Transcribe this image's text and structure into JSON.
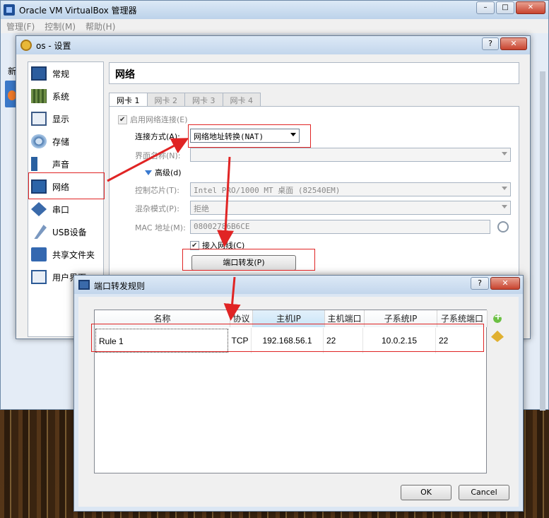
{
  "manager": {
    "title": "Oracle VM VirtualBox 管理器",
    "menu": [
      "管理(F)",
      "控制(M)",
      "帮助(H)"
    ],
    "new_label": "新",
    "win_min": "–",
    "win_max": "□",
    "win_close": "✕"
  },
  "settings": {
    "title": "os - 设置",
    "help": "?",
    "close": "✕",
    "page_title": "网络",
    "categories": [
      {
        "label": "常规",
        "icon": "general-icon"
      },
      {
        "label": "系统",
        "icon": "system-icon"
      },
      {
        "label": "显示",
        "icon": "display-icon"
      },
      {
        "label": "存储",
        "icon": "storage-icon"
      },
      {
        "label": "声音",
        "icon": "audio-icon"
      },
      {
        "label": "网络",
        "icon": "network-icon"
      },
      {
        "label": "串口",
        "icon": "serial-port-icon"
      },
      {
        "label": "USB设备",
        "icon": "usb-icon"
      },
      {
        "label": "共享文件夹",
        "icon": "shared-folder-icon"
      },
      {
        "label": "用户界面",
        "icon": "user-interface-icon"
      }
    ],
    "selected_category": "网络",
    "tabs": [
      "网卡 1",
      "网卡 2",
      "网卡 3",
      "网卡 4"
    ],
    "enable_adapter": "启用网络连接(E)",
    "attached_to_label": "连接方式(A):",
    "attached_to_value": "网络地址转换(NAT)",
    "name_label": "界面名称(N):",
    "name_value": "",
    "advanced_label": "高级(d)",
    "adapter_type_label": "控制芯片(T):",
    "adapter_type_value": "Intel PRO/1000 MT 桌面 (82540EM)",
    "promisc_label": "混杂模式(P):",
    "promisc_value": "拒绝",
    "mac_label": "MAC 地址(M):",
    "mac_value": "08002786B6CE",
    "cable_connected": "接入网线(C)",
    "port_forward_button": "端口转发(P)"
  },
  "port_forwarding": {
    "title": "端口转发规则",
    "help": "?",
    "close": "✕",
    "columns": [
      "名称",
      "协议",
      "主机IP",
      "主机端口",
      "子系统IP",
      "子系统端口"
    ],
    "rows": [
      {
        "name": "Rule 1",
        "protocol": "TCP",
        "host_ip": "192.168.56.1",
        "host_port": "22",
        "guest_ip": "10.0.2.15",
        "guest_port": "22"
      }
    ],
    "ok": "OK",
    "cancel": "Cancel"
  },
  "colors": {
    "annotation_red": "#e02424",
    "title_bar": "#c3d6ec",
    "close_button": "#c8432e"
  }
}
